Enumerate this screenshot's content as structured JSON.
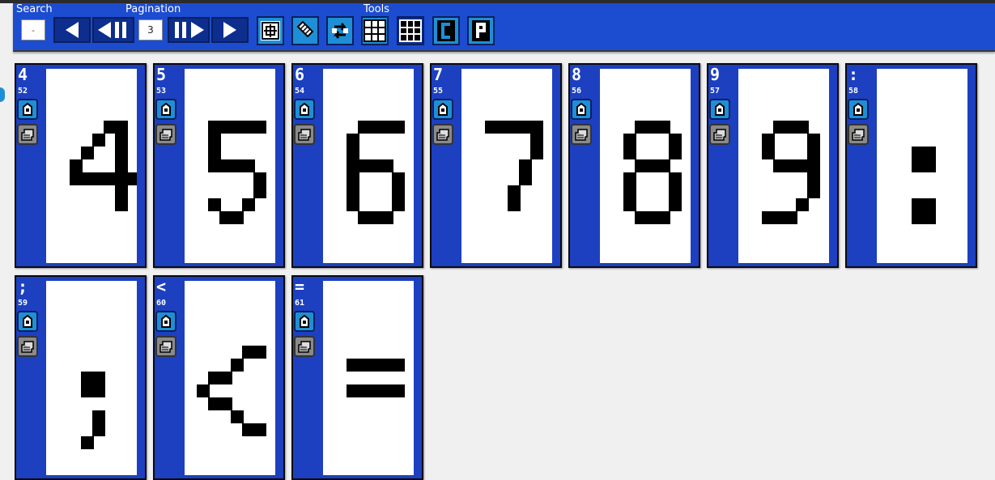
{
  "toolbar": {
    "search_label": "Search",
    "search_value": "-",
    "pagination_label": "Pagination",
    "page_value": "3",
    "tools_label": "Tools"
  },
  "icons": {
    "first": "prev-icon",
    "prev_page": "rewind-icon",
    "next_page": "fast-forward-icon",
    "last": "next-icon",
    "tools": [
      "shift-tool-icon",
      "dither-tool-icon",
      "rotate-tool-icon",
      "grid-icon",
      "grid-dark-icon",
      "char-c-icon",
      "char-p-icon"
    ],
    "card_edit": "save-glyph-icon",
    "card_copy": "copy-glyph-icon"
  },
  "colors": {
    "toolbar": "#1c4ccf",
    "card": "#1c40c0",
    "tool_button": "#1e8fd6",
    "pixel": "#000000"
  },
  "cards": [
    {
      "char": "4",
      "code": "52",
      "glyph": [
        "00000000",
        "00000000",
        "00000000",
        "00000000",
        "00000110",
        "00001010",
        "00010010",
        "00100010",
        "00111111",
        "00000010",
        "00000010",
        "00000000",
        "00000000",
        "00000000",
        "00000000"
      ]
    },
    {
      "char": "5",
      "code": "53",
      "glyph": [
        "00000000",
        "00000000",
        "00000000",
        "00000000",
        "00111110",
        "00100000",
        "00100000",
        "00111100",
        "00000010",
        "00000010",
        "00100100",
        "00011000",
        "00000000",
        "00000000",
        "00000000"
      ]
    },
    {
      "char": "6",
      "code": "54",
      "glyph": [
        "00000000",
        "00000000",
        "00000000",
        "00000000",
        "00011110",
        "00100000",
        "00100000",
        "00111100",
        "00100010",
        "00100010",
        "00100010",
        "00011100",
        "00000000",
        "00000000",
        "00000000"
      ]
    },
    {
      "char": "7",
      "code": "55",
      "glyph": [
        "00000000",
        "00000000",
        "00000000",
        "00000000",
        "00111110",
        "00000010",
        "00000010",
        "00000100",
        "00000100",
        "00001000",
        "00001000",
        "00000000",
        "00000000",
        "00000000",
        "00000000"
      ]
    },
    {
      "char": "8",
      "code": "56",
      "glyph": [
        "00000000",
        "00000000",
        "00000000",
        "00000000",
        "00011100",
        "00100010",
        "00100010",
        "00011100",
        "00100010",
        "00100010",
        "00100010",
        "00011100",
        "00000000",
        "00000000",
        "00000000"
      ]
    },
    {
      "char": "9",
      "code": "57",
      "glyph": [
        "00000000",
        "00000000",
        "00000000",
        "00000000",
        "00011100",
        "00100010",
        "00100010",
        "00011110",
        "00000010",
        "00000010",
        "00000100",
        "00111000",
        "00000000",
        "00000000",
        "00000000"
      ]
    },
    {
      "char": ":",
      "code": "58",
      "glyph": [
        "00000000",
        "00000000",
        "00000000",
        "00000000",
        "00000000",
        "00000000",
        "00011000",
        "00011000",
        "00000000",
        "00000000",
        "00011000",
        "00011000",
        "00000000",
        "00000000",
        "00000000"
      ]
    },
    {
      "char": ";",
      "code": "59",
      "glyph": [
        "00000000",
        "00000000",
        "00000000",
        "00000000",
        "00000000",
        "00000000",
        "00000000",
        "00011000",
        "00011000",
        "00000000",
        "00001000",
        "00001000",
        "00010000",
        "00000000",
        "00000000"
      ]
    },
    {
      "char": "<",
      "code": "60",
      "glyph": [
        "00000000",
        "00000000",
        "00000000",
        "00000000",
        "00000000",
        "00000110",
        "00001000",
        "00110000",
        "01000000",
        "00110000",
        "00001000",
        "00000110",
        "00000000",
        "00000000",
        "00000000"
      ]
    },
    {
      "char": "=",
      "code": "61",
      "glyph": [
        "00000000",
        "00000000",
        "00000000",
        "00000000",
        "00000000",
        "00000000",
        "00111110",
        "00000000",
        "00111110",
        "00000000",
        "00000000",
        "00000000",
        "00000000",
        "00000000",
        "00000000"
      ]
    }
  ]
}
